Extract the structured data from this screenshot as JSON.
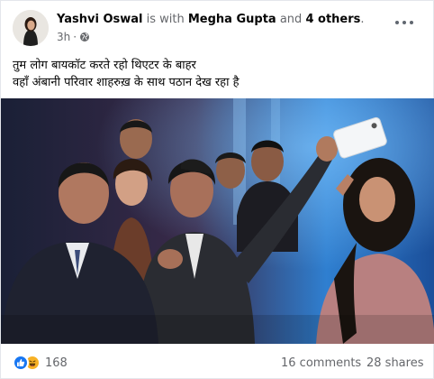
{
  "post": {
    "author": "Yashvi Oswal",
    "with_text": "is with",
    "tagged_person": "Megha Gupta",
    "and_text": "and",
    "others_link": "4 others",
    "timestamp": "3h",
    "dot": "·",
    "audience_icon": "globe-icon",
    "caption_lines": [
      "तुम लोग बायकॉट करते रहो थिएटर के बाहर",
      "वहाँ अंबानी परिवार शाहरुख़ के साथ पठान देख रहा है"
    ]
  },
  "stats": {
    "reaction_icons": [
      "like-icon",
      "haha-icon"
    ],
    "reaction_count": "168",
    "comments": "16 comments",
    "shares": "28 shares"
  },
  "colors": {
    "text": "#050505",
    "muted": "#65676b",
    "like": "#1877f2",
    "haha": "#f7b125"
  }
}
